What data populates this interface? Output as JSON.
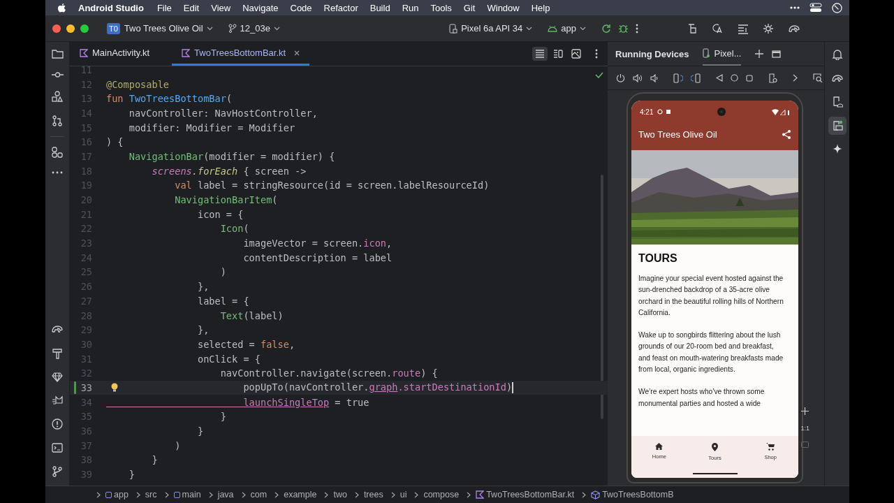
{
  "menu_bar": {
    "app_name": "Android Studio",
    "items": [
      "File",
      "Edit",
      "View",
      "Navigate",
      "Code",
      "Refactor",
      "Build",
      "Run",
      "Tools",
      "Git",
      "Window",
      "Help"
    ]
  },
  "title_bar": {
    "project_badge": "T0",
    "project": "Two Trees Olive Oil",
    "branch": "12_03e",
    "device": "Pixel 6a API 34",
    "run_config": "app"
  },
  "editor_tabs": [
    {
      "label": "MainActivity.kt",
      "selected": false,
      "closable": false
    },
    {
      "label": "TwoTreesBottomBar.kt",
      "selected": true,
      "closable": true
    }
  ],
  "view_modes": [
    {
      "kind": "code",
      "selected": true
    },
    {
      "kind": "split",
      "selected": false
    },
    {
      "kind": "design",
      "selected": false
    }
  ],
  "code_lines": [
    {
      "number": "11",
      "current": false,
      "changed": false
    },
    {
      "number": "12",
      "current": false,
      "changed": false,
      "segments": [
        {
          "t": "@Composable",
          "kind": "annotation"
        }
      ]
    },
    {
      "number": "13",
      "current": false,
      "changed": false,
      "segments": [
        {
          "t": "fun ",
          "kind": "keyword"
        },
        {
          "t": "TwoTreesBottomBar",
          "kind": "declaration"
        },
        {
          "t": "(",
          "kind": "plain"
        }
      ]
    },
    {
      "number": "14",
      "current": false,
      "changed": false,
      "segments": [
        {
          "t": "    navController: NavHostController,",
          "kind": "plain"
        }
      ]
    },
    {
      "number": "15",
      "current": false,
      "changed": false,
      "segments": [
        {
          "t": "    modifier: Modifier = Modifier",
          "kind": "plain"
        }
      ]
    },
    {
      "number": "16",
      "current": false,
      "changed": false,
      "segments": [
        {
          "t": ") {",
          "kind": "plain"
        }
      ]
    },
    {
      "number": "17",
      "current": false,
      "changed": false,
      "segments": [
        {
          "t": "    NavigationBar",
          "kind": "composable"
        },
        {
          "t": "(modifier = modifier) {",
          "kind": "plain"
        }
      ]
    },
    {
      "number": "18",
      "current": false,
      "changed": false,
      "segments": [
        {
          "t": "        screens",
          "kind": "property_italic"
        },
        {
          "t": ".forEach",
          "kind": "extension"
        },
        {
          "t": " { screen ->",
          "kind": "plain"
        }
      ]
    },
    {
      "number": "19",
      "current": false,
      "changed": false,
      "segments": [
        {
          "t": "            val",
          "kind": "keyword"
        },
        {
          "t": " label = stringResource(id = screen.labelResourceId)",
          "kind": "plain"
        }
      ]
    },
    {
      "number": "20",
      "current": false,
      "changed": false,
      "segments": [
        {
          "t": "            NavigationBarItem",
          "kind": "composable"
        },
        {
          "t": "(",
          "kind": "plain"
        }
      ]
    },
    {
      "number": "21",
      "current": false,
      "changed": false,
      "segments": [
        {
          "t": "                icon = {",
          "kind": "plain"
        }
      ]
    },
    {
      "number": "22",
      "current": false,
      "changed": false,
      "segments": [
        {
          "t": "                    Icon",
          "kind": "composable"
        },
        {
          "t": "(",
          "kind": "plain"
        }
      ]
    },
    {
      "number": "23",
      "current": false,
      "changed": false,
      "segments": [
        {
          "t": "                        imageVector = screen.",
          "kind": "plain"
        },
        {
          "t": "icon",
          "kind": "property"
        },
        {
          "t": ",",
          "kind": "plain"
        }
      ]
    },
    {
      "number": "24",
      "current": false,
      "changed": false,
      "segments": [
        {
          "t": "                        contentDescription = label",
          "kind": "plain"
        }
      ]
    },
    {
      "number": "25",
      "current": false,
      "changed": false,
      "segments": [
        {
          "t": "                    )",
          "kind": "plain"
        }
      ]
    },
    {
      "number": "26",
      "current": false,
      "changed": false,
      "segments": [
        {
          "t": "                },",
          "kind": "plain"
        }
      ]
    },
    {
      "number": "27",
      "current": false,
      "changed": false,
      "segments": [
        {
          "t": "                label = {",
          "kind": "plain"
        }
      ]
    },
    {
      "number": "28",
      "current": false,
      "changed": false,
      "segments": [
        {
          "t": "                    Text",
          "kind": "composable"
        },
        {
          "t": "(label)",
          "kind": "plain"
        }
      ]
    },
    {
      "number": "29",
      "current": false,
      "changed": false,
      "segments": [
        {
          "t": "                },",
          "kind": "plain"
        }
      ]
    },
    {
      "number": "30",
      "current": false,
      "changed": false,
      "segments": [
        {
          "t": "                selected = ",
          "kind": "plain"
        },
        {
          "t": "false",
          "kind": "keyword"
        },
        {
          "t": ",",
          "kind": "plain"
        }
      ]
    },
    {
      "number": "31",
      "current": false,
      "changed": false,
      "segments": [
        {
          "t": "                onClick = {",
          "kind": "plain"
        }
      ]
    },
    {
      "number": "32",
      "current": false,
      "changed": false,
      "segments": [
        {
          "t": "                    navController.navigate(screen.",
          "kind": "plain"
        },
        {
          "t": "route",
          "kind": "property"
        },
        {
          "t": ") {",
          "kind": "plain"
        }
      ]
    },
    {
      "number": "33",
      "current": true,
      "changed": true,
      "segments": [
        {
          "t": "                        popUpTo(navController.",
          "kind": "plain"
        },
        {
          "t": "graph",
          "kind": "property_underlined"
        },
        {
          "t": ".startDestinationId",
          "kind": "property"
        },
        {
          "t": ")",
          "kind": "plain"
        }
      ]
    },
    {
      "number": "34",
      "current": false,
      "changed": false,
      "segments": [
        {
          "t": "                        launchSingleTop",
          "kind": "property_underlined"
        },
        {
          "t": " = true",
          "kind": "plain"
        }
      ]
    },
    {
      "number": "35",
      "current": false,
      "changed": false,
      "segments": [
        {
          "t": "                    }",
          "kind": "plain"
        }
      ]
    },
    {
      "number": "36",
      "current": false,
      "changed": false,
      "segments": [
        {
          "t": "                }",
          "kind": "plain"
        }
      ]
    },
    {
      "number": "37",
      "current": false,
      "changed": false,
      "segments": [
        {
          "t": "            )",
          "kind": "plain"
        }
      ]
    },
    {
      "number": "38",
      "current": false,
      "changed": false,
      "segments": [
        {
          "t": "        }",
          "kind": "plain"
        }
      ]
    },
    {
      "number": "39",
      "current": false,
      "changed": false,
      "segments": [
        {
          "t": "    }",
          "kind": "plain"
        }
      ]
    }
  ],
  "breadcrumbs": [
    {
      "label": "app",
      "kind": "module"
    },
    {
      "label": "src",
      "kind": "folder"
    },
    {
      "label": "main",
      "kind": "module"
    },
    {
      "label": "java",
      "kind": "folder"
    },
    {
      "label": "com",
      "kind": "folder"
    },
    {
      "label": "example",
      "kind": "folder"
    },
    {
      "label": "two",
      "kind": "folder"
    },
    {
      "label": "trees",
      "kind": "folder"
    },
    {
      "label": "ui",
      "kind": "folder"
    },
    {
      "label": "compose",
      "kind": "folder"
    },
    {
      "label": "TwoTreesBottomBar.kt",
      "kind": "kotlin_file"
    },
    {
      "label": "TwoTreesBottomB",
      "kind": "composable"
    }
  ],
  "running_devices": {
    "title": "Running Devices",
    "device_tab": "Pixel..."
  },
  "phone": {
    "time": "4:21",
    "app_title": "Two Trees Olive Oil",
    "heading": "TOURS",
    "paragraphs": [
      "Imagine your special event hosted against the sun-drenched backdrop of a 35-acre olive orchard in the beautiful rolling hills of Northern California.",
      "Wake up to songbirds flittering about the lush grounds of our 20-room bed and breakfast, and feast on mouth-watering breakfasts made from local, organic ingredients.",
      "We’re expert hosts who’ve thrown some monumental parties and hosted a wide"
    ],
    "nav_items": [
      {
        "label": "Home",
        "kind": "home"
      },
      {
        "label": "Tours",
        "kind": "place"
      },
      {
        "label": "Shop",
        "kind": "cart"
      }
    ]
  },
  "zoom_controls": {
    "actual_size": "1:1"
  }
}
